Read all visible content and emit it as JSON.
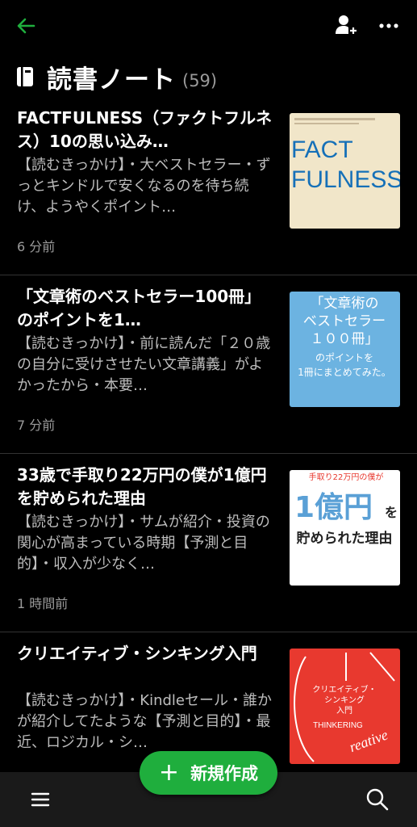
{
  "header": {
    "title": "読書ノート",
    "count": "(59)"
  },
  "notes": [
    {
      "title": "FACTFULNESS（ファクトフルネス）10の思い込み…",
      "snippet": "【読むきっかけ】・大ベストセラー・ずっとキンドルで安くなるのを待ち続け、ようやくポイント…",
      "time": "6 分前",
      "cover": {
        "bg": "#f1e6c9",
        "text1": "FACT",
        "text2": "FULNESS",
        "color": "#1570b8"
      }
    },
    {
      "title": "「文章術のベストセラー100冊」のポイントを1…",
      "snippet": "【読むきっかけ】・前に読んだ「２０歳の自分に受けさせたい文章講義」がよかったから・本要…",
      "time": "7 分前",
      "cover": {
        "bg": "#6cb3e1",
        "line1": "「文章術の",
        "line2": "ベストセラー",
        "line3": "１００冊」",
        "line4": "のポイントを",
        "line5": "1冊にまとめてみた。"
      }
    },
    {
      "title": "33歳で手取り22万円の僕が1億円を貯められた理由",
      "snippet": "【読むきっかけ】・サムが紹介・投資の関心が高まっている時期【予測と目的】・収入が少なく…",
      "time": "1 時間前",
      "cover": {
        "bg": "#ffffff",
        "top": "手取り22万円の僕が",
        "big": "1億円",
        "post": "を",
        "bottom": "貯められた理由"
      }
    },
    {
      "title": "クリエイティブ・シンキング入門",
      "snippet": "【読むきっかけ】・Kindleセール・誰かが紹介してたような【予測と目的】・最近、ロジカル・シ…",
      "time": "",
      "cover": {
        "bg": "#e8392f",
        "t1": "クリエイティブ・",
        "t2": "シンキング",
        "t3": "入門",
        "t4": "THINKERING",
        "t5": "reative"
      }
    }
  ],
  "fab": {
    "plus": "+",
    "label": "新規作成"
  },
  "icons": {
    "back": "back-arrow-icon",
    "add_user": "add-user-icon",
    "more": "more-dots-icon",
    "menu": "hamburger-menu-icon",
    "search": "search-icon"
  },
  "colors": {
    "accent": "#1fae3d"
  }
}
